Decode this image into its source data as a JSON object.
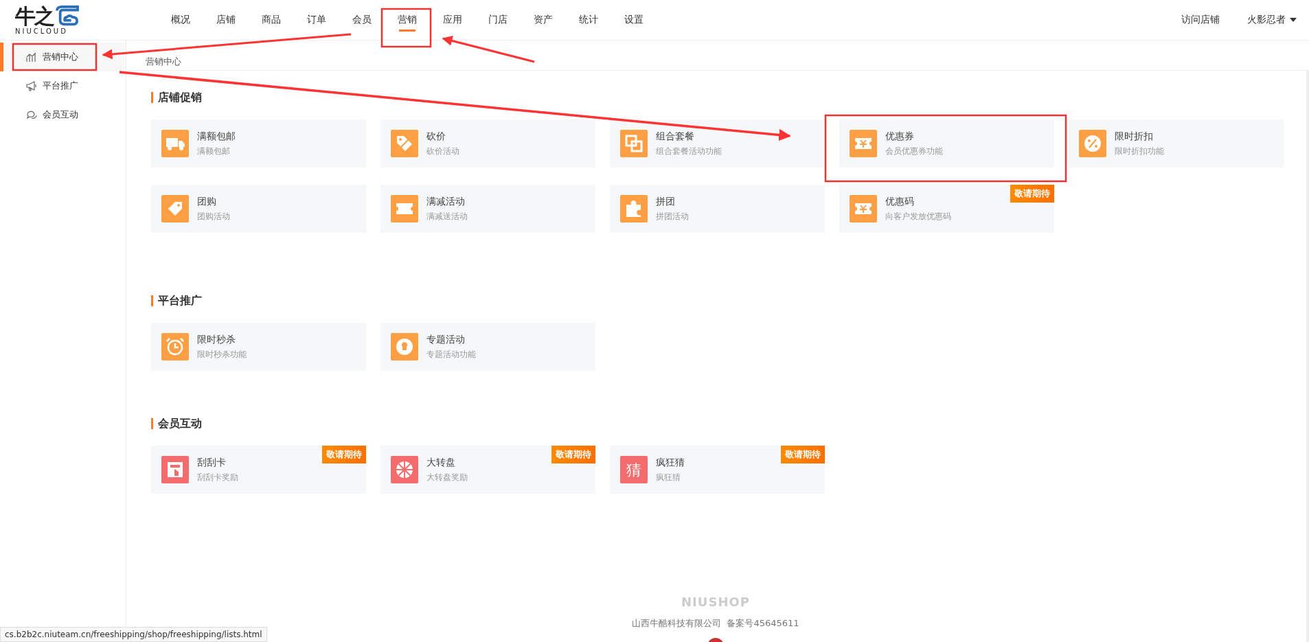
{
  "header": {
    "logo_text": "牛之",
    "logo_sub": "NIUCLOUD",
    "nav": [
      {
        "label": "概况",
        "selected": false
      },
      {
        "label": "店铺",
        "selected": false
      },
      {
        "label": "商品",
        "selected": false
      },
      {
        "label": "订单",
        "selected": false
      },
      {
        "label": "会员",
        "selected": false
      },
      {
        "label": "营销",
        "selected": true
      },
      {
        "label": "应用",
        "selected": false
      },
      {
        "label": "门店",
        "selected": false
      },
      {
        "label": "资产",
        "selected": false
      },
      {
        "label": "统计",
        "selected": false
      },
      {
        "label": "设置",
        "selected": false
      }
    ],
    "visit_store": "访问店铺",
    "user": "火影忍者"
  },
  "sidebar": {
    "items": [
      {
        "label": "营销中心",
        "kind": "chart",
        "selected": true
      },
      {
        "label": "平台推广",
        "kind": "megaphone",
        "selected": false
      },
      {
        "label": "会员互动",
        "kind": "chat",
        "selected": false
      }
    ]
  },
  "breadcrumb": "营销中心",
  "sections": [
    {
      "title": "店铺促销",
      "cards": [
        {
          "title": "满额包邮",
          "desc": "满额包邮",
          "kind": "truck",
          "color": "#ff9f43"
        },
        {
          "title": "砍价",
          "desc": "砍价活动",
          "kind": "tag-cut",
          "color": "#ff9f43"
        },
        {
          "title": "组合套餐",
          "desc": "组合套餐活动功能",
          "kind": "squares",
          "color": "#ff9f43"
        },
        {
          "title": "优惠券",
          "desc": "会员优惠券功能",
          "kind": "ticket",
          "color": "#ff9f43"
        },
        {
          "title": "限时折扣",
          "desc": "限时折扣功能",
          "kind": "percent",
          "color": "#ff9f43"
        },
        {
          "title": "团购",
          "desc": "团购活动",
          "kind": "tag",
          "color": "#ff9f43"
        },
        {
          "title": "满减活动",
          "desc": "满减送活动",
          "kind": "ticket-plain",
          "color": "#ff9f43"
        },
        {
          "title": "拼团",
          "desc": "拼团活动",
          "kind": "puzzle",
          "color": "#ff9f43"
        },
        {
          "title": "优惠码",
          "desc": "向客户发放优惠码",
          "kind": "ticket",
          "color": "#ff9f43",
          "badge": "敬请期待"
        }
      ]
    },
    {
      "title": "平台推广",
      "cards": [
        {
          "title": "限时秒杀",
          "desc": "限时秒杀功能",
          "kind": "clock",
          "color": "#ff9f43"
        },
        {
          "title": "专题活动",
          "desc": "专题活动功能",
          "kind": "bulb",
          "color": "#ff9f43"
        }
      ]
    },
    {
      "title": "会员互动",
      "cards": [
        {
          "title": "刮刮卡",
          "desc": "刮刮卡奖励",
          "kind": "scratch",
          "color": "#f56c6c",
          "badge": "敬请期待"
        },
        {
          "title": "大转盘",
          "desc": "大转盘奖励",
          "kind": "wheel",
          "color": "#f56c6c",
          "badge": "敬请期待"
        },
        {
          "title": "疯狂猜",
          "desc": "疯狂猜",
          "kind": "char",
          "icon_text": "猜",
          "color": "#f56c6c",
          "badge": "敬请期待"
        }
      ]
    }
  ],
  "footer": {
    "brand": "NIUSHOP",
    "company": "山西牛酷科技有限公司",
    "record": "备案号45645611"
  },
  "status_url": "cs.b2b2c.niuteam.cn/freeshipping/shop/freeshipping/lists.html"
}
